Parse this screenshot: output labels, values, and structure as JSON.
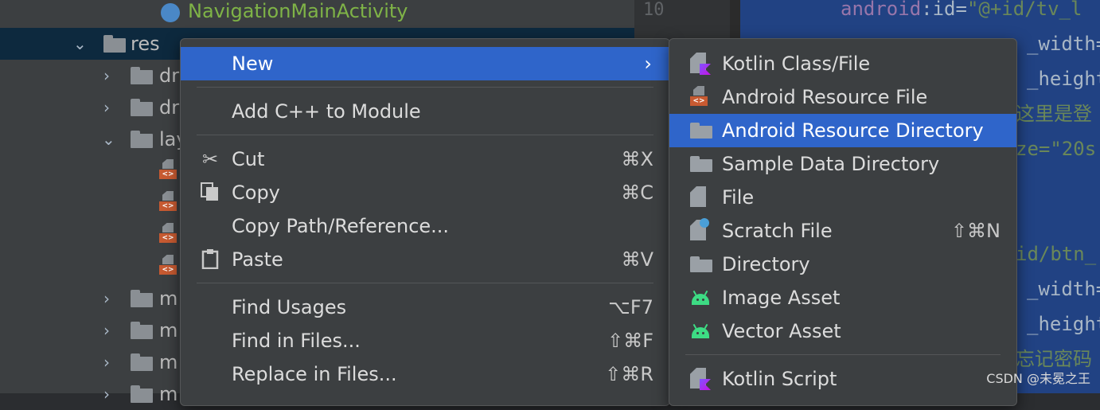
{
  "tree": {
    "activity": "NavigationMainActivity",
    "res": "res",
    "items": [
      "dr",
      "dr",
      "lay",
      "m",
      "m",
      "m",
      "m"
    ]
  },
  "gutter": {
    "line": "10"
  },
  "code": {
    "lines": [
      {
        "attr": "android",
        "rest": ":id=",
        "str": "\"@+id/tv_l"
      },
      {
        "attr": "",
        "rest": "",
        "str": "_width="
      },
      {
        "attr": "",
        "rest": "",
        "str": "_height"
      },
      {
        "attr": "",
        "rest": "",
        "str": "这里是登"
      },
      {
        "attr": "",
        "rest": "",
        "str": "ze=\"20s"
      },
      {
        "attr": "",
        "rest": "",
        "str": "id/btn_"
      },
      {
        "attr": "",
        "rest": "",
        "str": "_width="
      },
      {
        "attr": "",
        "rest": "",
        "str": "_height"
      },
      {
        "attr": "",
        "rest": "",
        "str": "忘记密码"
      }
    ]
  },
  "menu": {
    "new": "New",
    "add_cpp": "Add C++ to Module",
    "cut": "Cut",
    "cut_sc": "⌘X",
    "copy": "Copy",
    "copy_sc": "⌘C",
    "copy_path": "Copy Path/Reference...",
    "paste": "Paste",
    "paste_sc": "⌘V",
    "find_usages": "Find Usages",
    "find_usages_sc": "⌥F7",
    "find_in_files": "Find in Files...",
    "find_in_files_sc": "⇧⌘F",
    "replace_in_files": "Replace in Files...",
    "replace_in_files_sc": "⇧⌘R"
  },
  "submenu": {
    "kotlin_class": "Kotlin Class/File",
    "android_resource_file": "Android Resource File",
    "android_resource_directory": "Android Resource Directory",
    "sample_data_directory": "Sample Data Directory",
    "file": "File",
    "scratch_file": "Scratch File",
    "scratch_file_sc": "⇧⌘N",
    "directory": "Directory",
    "image_asset": "Image Asset",
    "vector_asset": "Vector Asset",
    "kotlin_script": "Kotlin Script"
  },
  "watermark": "CSDN @未冕之王",
  "colors": {
    "highlight": "#2f65ca",
    "editor_selection": "#214283",
    "menu_bg": "#3c3f41"
  }
}
